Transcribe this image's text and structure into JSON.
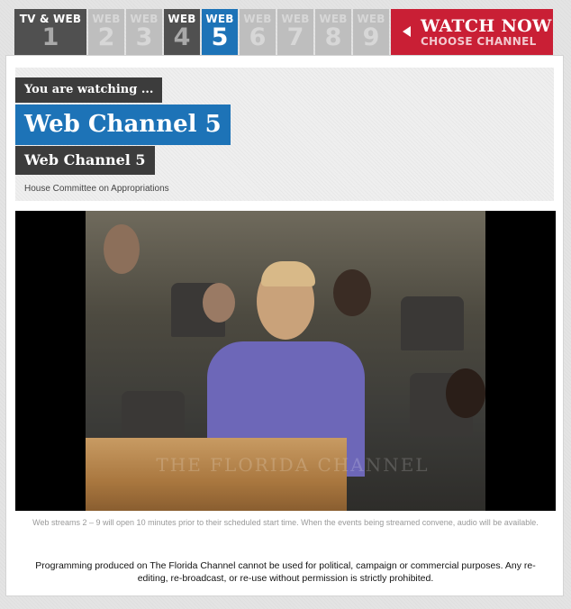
{
  "tabs": [
    {
      "label": "TV & WEB",
      "num": "1",
      "state": "tv"
    },
    {
      "label": "WEB",
      "num": "2",
      "state": "inactive"
    },
    {
      "label": "WEB",
      "num": "3",
      "state": "inactive"
    },
    {
      "label": "WEB",
      "num": "4",
      "state": "dark"
    },
    {
      "label": "WEB",
      "num": "5",
      "state": "active"
    },
    {
      "label": "WEB",
      "num": "6",
      "state": "inactive"
    },
    {
      "label": "WEB",
      "num": "7",
      "state": "inactive"
    },
    {
      "label": "WEB",
      "num": "8",
      "state": "inactive"
    },
    {
      "label": "WEB",
      "num": "9",
      "state": "inactive"
    }
  ],
  "watch_now": {
    "title": "WATCH NOW",
    "subtitle": "CHOOSE CHANNEL",
    "icon": "left-arrow-icon"
  },
  "header": {
    "watching": "You are watching ...",
    "channel_title": "Web Channel 5",
    "channel_sub": "Web Channel 5",
    "committee": "House Committee on Appropriations"
  },
  "player": {
    "watermark": "THE FLORIDA CHANNEL"
  },
  "notice": "Web streams 2 – 9 will open 10 minutes prior to their scheduled start time. When the events being streamed convene, audio will be available.",
  "disclaimer": "Programming produced on The Florida Channel cannot be used for political, campaign or commercial purposes. Any re-editing, re-broadcast, or re-use without permission is strictly prohibited.",
  "colors": {
    "active_tab": "#1d73b7",
    "watch_button": "#c91f35",
    "dark_label": "#3c3c3c"
  }
}
